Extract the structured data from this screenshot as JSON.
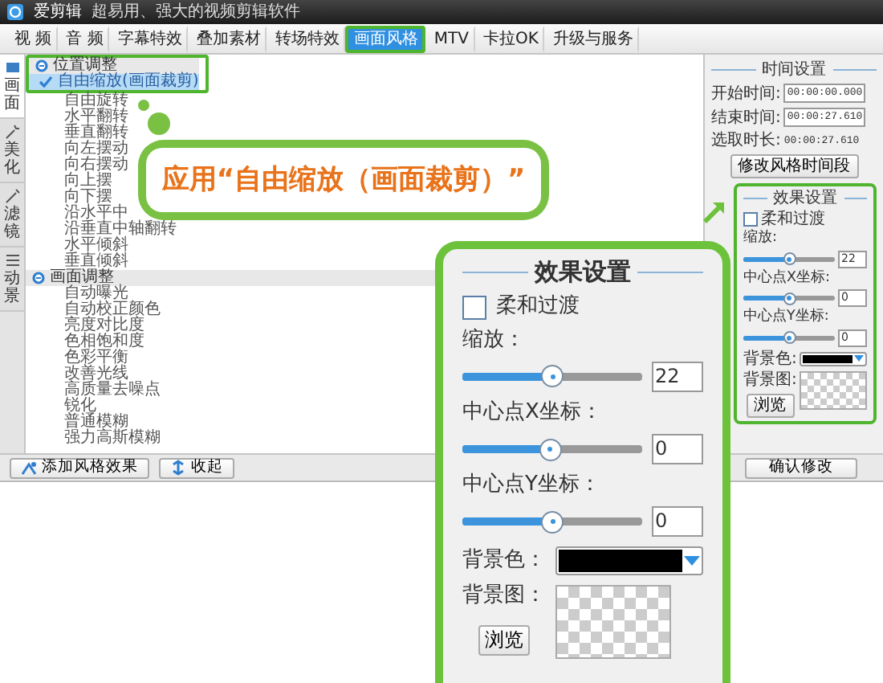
{
  "title_bar": {
    "app_name": "爱剪辑",
    "tagline": "超易用、强大的视频剪辑软件"
  },
  "main_tabs": [
    {
      "label": "视 频",
      "selected": false
    },
    {
      "label": "音 频",
      "selected": false
    },
    {
      "label": "字幕特效",
      "selected": false
    },
    {
      "label": "叠加素材",
      "selected": false
    },
    {
      "label": "转场特效",
      "selected": false
    },
    {
      "label": "画面风格",
      "selected": true
    },
    {
      "label": "MTV",
      "selected": false
    },
    {
      "label": "卡拉OK",
      "selected": false
    },
    {
      "label": "升级与服务",
      "selected": false
    }
  ],
  "side_tabs": [
    {
      "label": "画面",
      "selected": true
    },
    {
      "label": "美化",
      "selected": false
    },
    {
      "label": "滤镜",
      "selected": false
    },
    {
      "label": "动景",
      "selected": false
    }
  ],
  "effect_list": [
    {
      "label": "位置调整",
      "expanded": true,
      "children": [
        {
          "label": "自由缩放(画面裁剪)",
          "selected": true
        },
        {
          "label": "自由旋转",
          "selected": false
        },
        {
          "label": "水平翻转",
          "selected": false
        },
        {
          "label": "垂直翻转",
          "selected": false
        },
        {
          "label": "向左摆动",
          "selected": false
        },
        {
          "label": "向右摆动",
          "selected": false
        },
        {
          "label": "向上摆",
          "selected": false
        },
        {
          "label": "向下摆",
          "selected": false
        },
        {
          "label": "沿水平中",
          "selected": false
        },
        {
          "label": "沿垂直中轴翻转",
          "selected": false
        },
        {
          "label": "水平倾斜",
          "selected": false
        },
        {
          "label": "垂直倾斜",
          "selected": false
        }
      ]
    },
    {
      "label": "画面调整",
      "expanded": true,
      "children": [
        {
          "label": "自动曝光",
          "selected": false
        },
        {
          "label": "自动校正颜色",
          "selected": false
        },
        {
          "label": "亮度对比度",
          "selected": false
        },
        {
          "label": "色相饱和度",
          "selected": false
        },
        {
          "label": "色彩平衡",
          "selected": false
        },
        {
          "label": "改善光线",
          "selected": false
        },
        {
          "label": "高质量去噪点",
          "selected": false
        },
        {
          "label": "锐化",
          "selected": false
        },
        {
          "label": "普通模糊",
          "selected": false
        },
        {
          "label": "强力高斯模糊",
          "selected": false
        }
      ]
    }
  ],
  "time_settings": {
    "title": "时间设置",
    "fields": [
      {
        "label": "开始时间:",
        "value": "00:00:00.000",
        "kind": "input"
      },
      {
        "label": "结束时间:",
        "value": "00:00:27.610",
        "kind": "input"
      },
      {
        "label": "选取时长:",
        "value": "00:00:27.610",
        "kind": "text"
      }
    ],
    "button": "修改风格时间段"
  },
  "effect_settings": {
    "title": "效果设置",
    "soft_transition": {
      "label": "柔和过渡",
      "checked": false
    },
    "sliders": [
      {
        "label": "缩放:",
        "level": 0.5,
        "value": "22"
      },
      {
        "label": "中心点X坐标:",
        "level": 0.5,
        "value": "0"
      },
      {
        "label": "中心点Y坐标:",
        "level": 0.5,
        "value": "0"
      }
    ],
    "bg_color_label": "背景色:",
    "bg_image_label": "背景图:",
    "browse_button": "浏览"
  },
  "bottom_buttons": [
    {
      "label": "添加风格效果",
      "kind": "add"
    },
    {
      "label": "收起",
      "kind": "collapse"
    }
  ],
  "confirm_button": "确认修改",
  "callout": {
    "text": "应用“自由缩放（画面裁剪）”"
  },
  "effect_settings_zoomed": {
    "title": "效果设置",
    "soft_transition": {
      "label": "柔和过渡",
      "checked": false
    },
    "sliders": [
      {
        "label": "缩放：",
        "level": 0.5,
        "value": "22"
      },
      {
        "label": "中心点X坐标：",
        "level": 0.49,
        "value": "0"
      },
      {
        "label": "中心点Y坐标：",
        "level": 0.5,
        "value": "0"
      }
    ],
    "bg_color_label": "背景色：",
    "bg_image_label": "背景图：",
    "browse_button": "浏览"
  }
}
